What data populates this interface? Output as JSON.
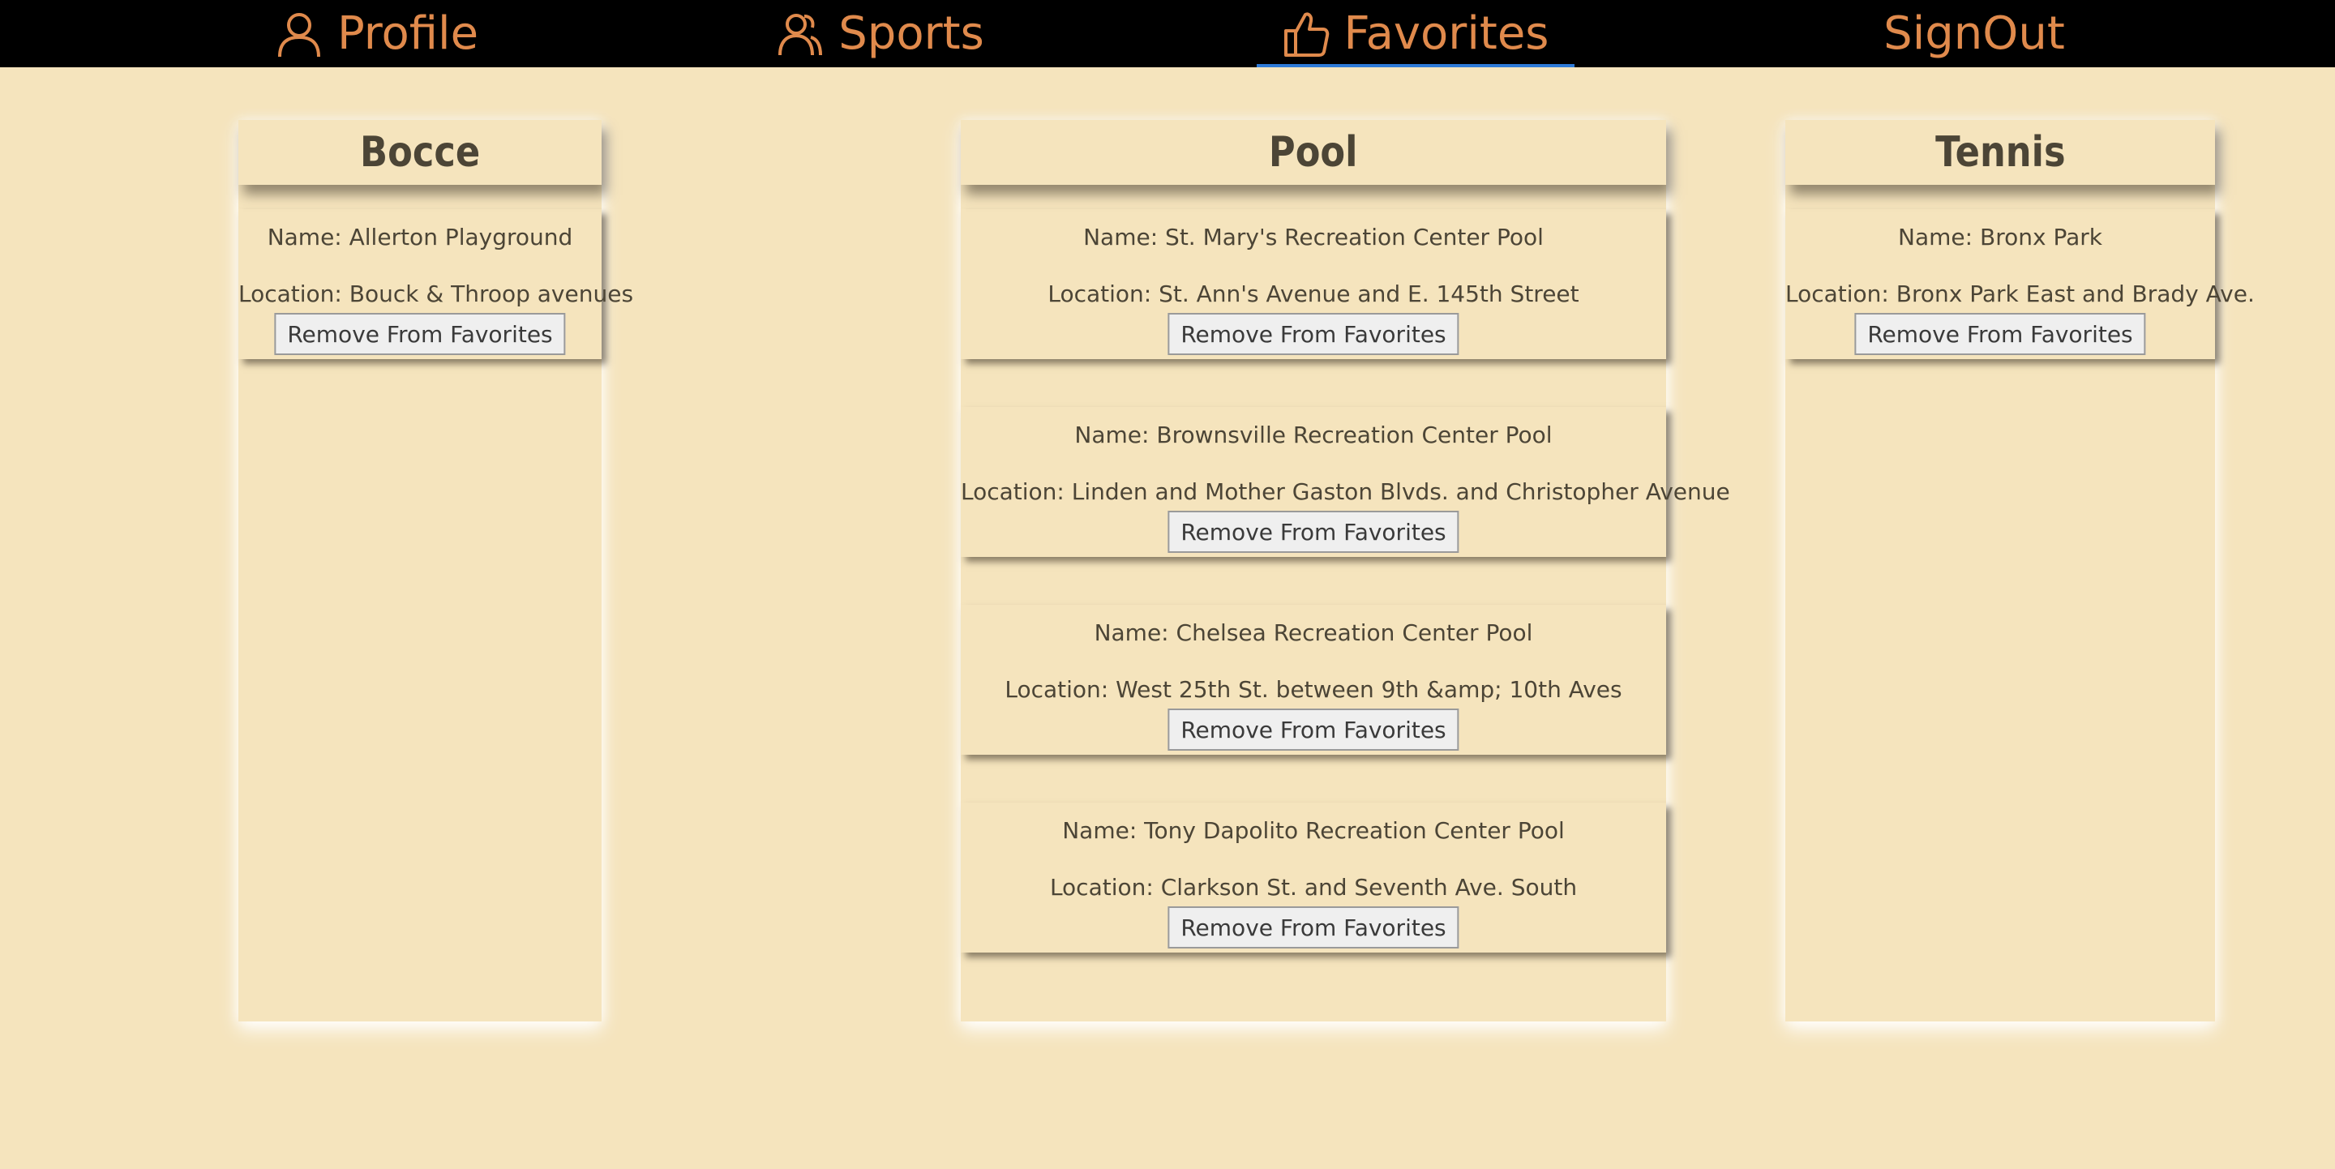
{
  "nav": {
    "profile": "Profile",
    "sports": "Sports",
    "favorites": "Favorites",
    "signout": "SignOut",
    "active": "Favorites",
    "accent_color": "#e08a4c",
    "active_underline_color": "#2e7ad8"
  },
  "columns": [
    {
      "title": "Bocce",
      "cards": [
        {
          "name": "Name: Allerton Playground",
          "location": "Location: Bouck & Throop avenues",
          "button": "Remove From Favorites"
        }
      ]
    },
    {
      "title": "Pool",
      "cards": [
        {
          "name": "Name: St. Mary's Recreation Center Pool",
          "location": "Location: St. Ann's Avenue and E. 145th Street",
          "button": "Remove From Favorites"
        },
        {
          "name": "Name: Brownsville Recreation Center Pool",
          "location": "Location: Linden and Mother Gaston Blvds. and Christopher Avenue",
          "button": "Remove From Favorites"
        },
        {
          "name": "Name: Chelsea Recreation Center Pool",
          "location": "Location: West 25th St. between 9th &amp; 10th Aves",
          "button": "Remove From Favorites"
        },
        {
          "name": "Name: Tony Dapolito Recreation Center Pool",
          "location": "Location: Clarkson St. and Seventh Ave. South",
          "button": "Remove From Favorites"
        }
      ]
    },
    {
      "title": "Tennis",
      "cards": [
        {
          "name": "Name: Bronx Park",
          "location": "Location: Bronx Park East and Brady Ave.",
          "button": "Remove From Favorites"
        }
      ]
    }
  ]
}
